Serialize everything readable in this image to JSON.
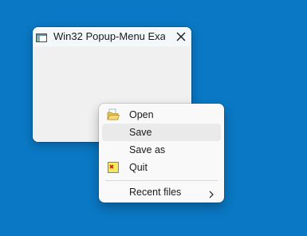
{
  "colors": {
    "desktop": "#0a78c4",
    "window_bg": "#f0f0f0",
    "titlebar_bg": "#f3f8fb",
    "menu_bg": "#f9f9f9",
    "menu_hover": "#eaeaea"
  },
  "window": {
    "title": "Win32 Popup-Menu Exa...",
    "icon": "window-app-icon",
    "close_icon": "close-icon"
  },
  "popup_menu": {
    "items": [
      {
        "label": "Open",
        "icon": "open-folder-icon"
      },
      {
        "label": "Save",
        "icon": null,
        "hovered": true
      },
      {
        "label": "Save as",
        "icon": null
      },
      {
        "label": "Quit",
        "icon": "quit-icon"
      }
    ],
    "submenu": {
      "label": "Recent files",
      "arrow": "chevron-right-icon"
    }
  }
}
